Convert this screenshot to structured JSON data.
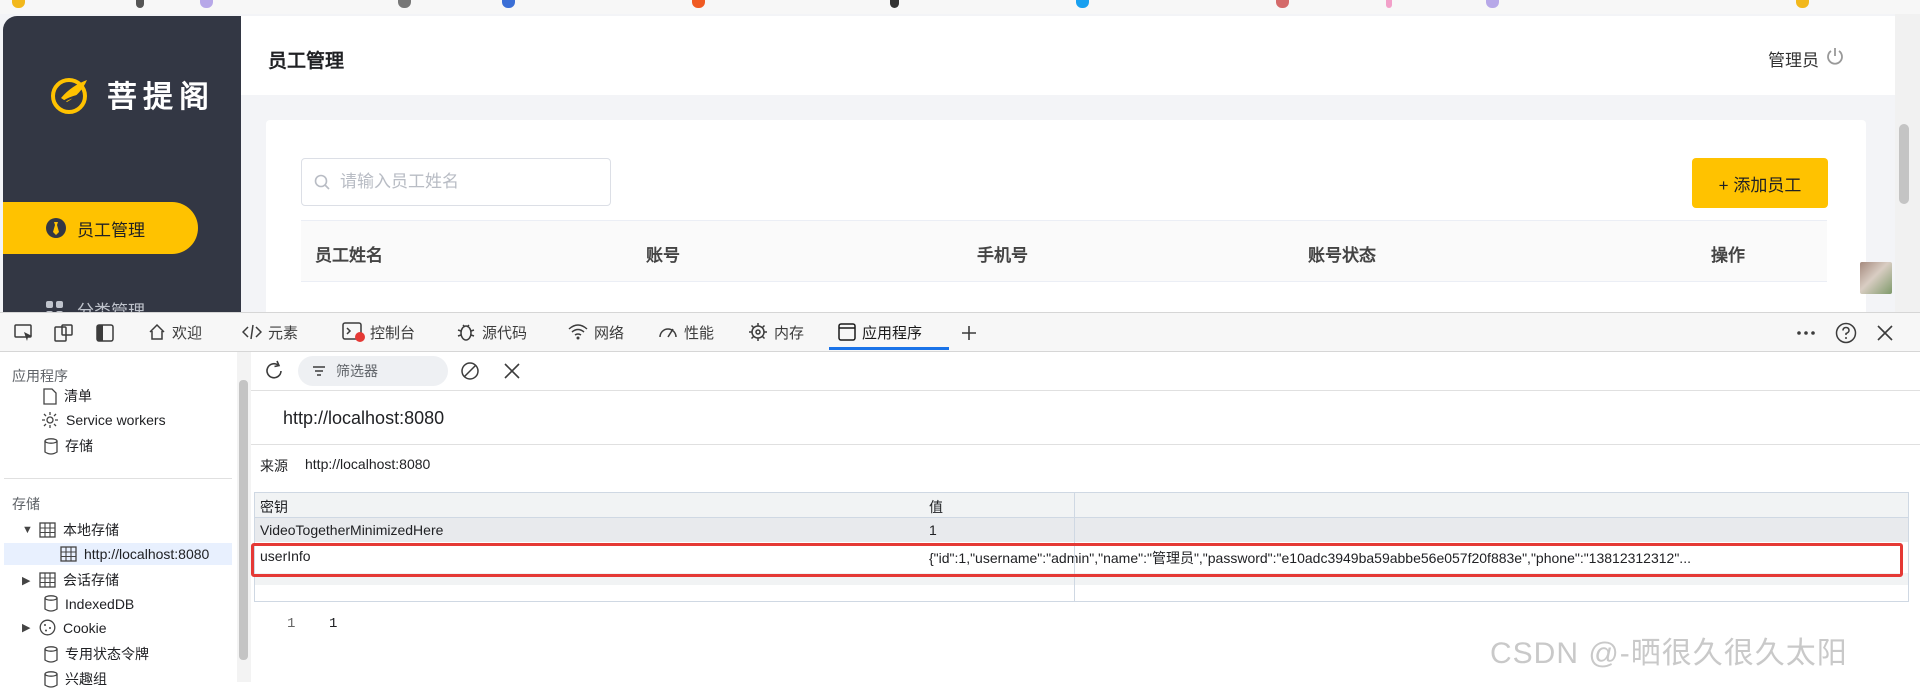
{
  "app": {
    "brand": "菩提阁",
    "nav_active": "员工管理",
    "nav_next": "分类管理",
    "page_title": "员工管理",
    "admin_name": "管理员",
    "search_placeholder": "请输入员工姓名",
    "add_button": "+ 添加员工",
    "table_headers": [
      "员工姓名",
      "账号",
      "手机号",
      "账号状态",
      "操作"
    ],
    "accent_color": "#ffc200",
    "sidebar_color": "#333744"
  },
  "devtools": {
    "tabs": [
      {
        "label": "欢迎",
        "icon": "home-icon"
      },
      {
        "label": "元素",
        "icon": "code-icon"
      },
      {
        "label": "控制台",
        "icon": "console-icon"
      },
      {
        "label": "源代码",
        "icon": "bug-icon"
      },
      {
        "label": "网络",
        "icon": "wifi-icon"
      },
      {
        "label": "性能",
        "icon": "gauge-icon"
      },
      {
        "label": "内存",
        "icon": "memory-icon"
      },
      {
        "label": "应用程序",
        "icon": "application-icon"
      }
    ],
    "active_tab": "应用程序",
    "sidebar": {
      "section_app": "应用程序",
      "manifest": "清单",
      "service_workers": "Service workers",
      "storage": "存储",
      "section_storage": "存储",
      "local_storage": "本地存储",
      "local_origin": "http://localhost:8080",
      "session_storage": "会话存储",
      "indexeddb": "IndexedDB",
      "cookie": "Cookie",
      "private_token": "专用状态令牌",
      "interest_groups": "兴趣组"
    },
    "filter_placeholder": "筛选器",
    "origin_title": "http://localhost:8080",
    "origin_label": "来源",
    "origin_value": "http://localhost:8080",
    "table": {
      "key_header": "密钥",
      "value_header": "值",
      "rows": [
        {
          "key": "VideoTogetherMinimizedHere",
          "value": "1"
        },
        {
          "key": "userInfo",
          "value": "{\"id\":1,\"username\":\"admin\",\"name\":\"管理员\",\"password\":\"e10adc3949ba59abbe56e057f20f883e\",\"phone\":\"13812312312\"..."
        }
      ]
    },
    "preview_line_number": "1",
    "preview_value": "1",
    "highlight_color": "#e53935"
  },
  "watermark": "CSDN @-晒很久很久太阳"
}
